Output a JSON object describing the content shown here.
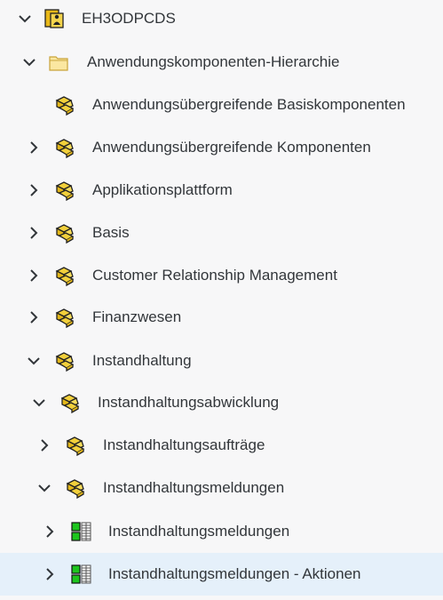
{
  "tree": {
    "rows": [
      {
        "label": "EH3ODPCDS",
        "icon": "system-icon",
        "state": "expanded"
      },
      {
        "label": "Anwendungskomponenten-Hierarchie",
        "icon": "folder-icon",
        "state": "expanded"
      },
      {
        "label": "Anwendungsübergreifende Basiskomponenten",
        "icon": "component-icon",
        "state": "leaf"
      },
      {
        "label": "Anwendungsübergreifende Komponenten",
        "icon": "component-icon",
        "state": "collapsed"
      },
      {
        "label": "Applikationsplattform",
        "icon": "component-icon",
        "state": "collapsed"
      },
      {
        "label": "Basis",
        "icon": "component-icon",
        "state": "collapsed"
      },
      {
        "label": "Customer Relationship Management",
        "icon": "component-icon",
        "state": "collapsed"
      },
      {
        "label": "Finanzwesen",
        "icon": "component-icon",
        "state": "collapsed"
      },
      {
        "label": "Instandhaltung",
        "icon": "component-icon",
        "state": "expanded"
      },
      {
        "label": "Instandhaltungsabwicklung",
        "icon": "component-icon",
        "state": "expanded"
      },
      {
        "label": "Instandhaltungsaufträge",
        "icon": "component-icon",
        "state": "collapsed"
      },
      {
        "label": "Instandhaltungsmeldungen",
        "icon": "component-icon",
        "state": "expanded"
      },
      {
        "label": "Instandhaltungsmeldungen",
        "icon": "cds-view-icon",
        "state": "collapsed"
      },
      {
        "label": "Instandhaltungsmeldungen - Aktionen",
        "icon": "cds-view-icon",
        "state": "collapsed",
        "selected": true
      }
    ]
  },
  "colors": {
    "background": "#f7f7f8",
    "selected_row": "#e5f0fa",
    "text": "#32363a",
    "chevron": "#32363a",
    "component_fill": "#f2d03b",
    "folder_fill": "#fbe7a1",
    "view_green": "#1ec51e"
  }
}
